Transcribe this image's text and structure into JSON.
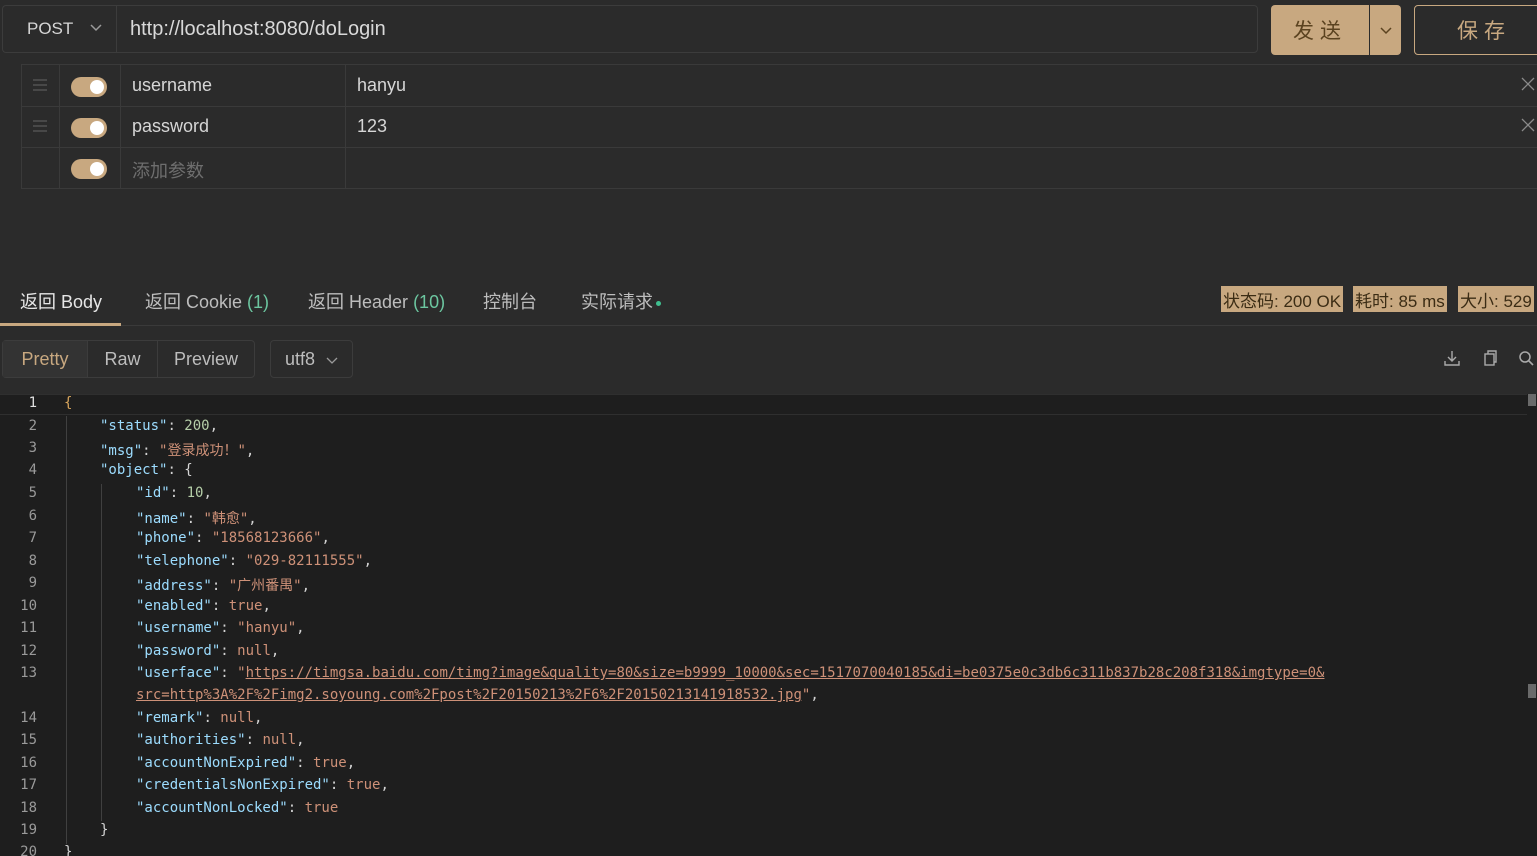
{
  "request": {
    "method": "POST",
    "url": "http://localhost:8080/doLogin",
    "send_label": "发送",
    "save_label": "保存"
  },
  "params": [
    {
      "key": "username",
      "value": "hanyu",
      "enabled": true
    },
    {
      "key": "password",
      "value": "123",
      "enabled": true
    }
  ],
  "add_param_placeholder": "添加参数",
  "response_tabs": [
    {
      "label": "返回 Body",
      "count": ""
    },
    {
      "label": "返回 Cookie",
      "count": "(1)"
    },
    {
      "label": "返回 Header",
      "count": "(10)"
    },
    {
      "label": "控制台",
      "count": ""
    },
    {
      "label": "实际请求",
      "count": ""
    }
  ],
  "status": {
    "status_code": "状态码: 200 OK",
    "time": "耗时: 85 ms",
    "size": "大小: 529"
  },
  "view_modes": [
    "Pretty",
    "Raw",
    "Preview"
  ],
  "encoding": "utf8",
  "toolbar_icons": [
    "download-icon",
    "copy-icon",
    "search-icon"
  ],
  "colors": {
    "accent": "#c8a880",
    "background": "#2b2b2b",
    "editor_background": "#1e1e1e",
    "json_key": "#9cdcfe",
    "json_string": "#ce9178",
    "json_number": "#b5cea8"
  },
  "code": {
    "line_numbers": [
      "1",
      "2",
      "3",
      "4",
      "5",
      "6",
      "7",
      "8",
      "9",
      "10",
      "11",
      "12",
      "13",
      "14",
      "15",
      "16",
      "17",
      "18",
      "19",
      "20"
    ],
    "lines": [
      {
        "p": "{",
        "t": "b"
      },
      {
        "k": "\"status\"",
        "p": ": ",
        "n": "200",
        "e": ","
      },
      {
        "k": "\"msg\"",
        "p": ": ",
        "s": "\"登录成功！\"",
        "e": ","
      },
      {
        "k": "\"object\"",
        "p": ": ",
        "b": "{"
      },
      {
        "k": "\"id\"",
        "p": ": ",
        "n": "10",
        "e": ","
      },
      {
        "k": "\"name\"",
        "p": ": ",
        "s": "\"韩愈\"",
        "e": ","
      },
      {
        "k": "\"phone\"",
        "p": ": ",
        "s": "\"18568123666\"",
        "e": ","
      },
      {
        "k": "\"telephone\"",
        "p": ": ",
        "s": "\"029-82111555\"",
        "e": ","
      },
      {
        "k": "\"address\"",
        "p": ": ",
        "s": "\"广州番禺\"",
        "e": ","
      },
      {
        "k": "\"enabled\"",
        "p": ": ",
        "s": "true",
        "e": ","
      },
      {
        "k": "\"username\"",
        "p": ": ",
        "s": "\"hanyu\"",
        "e": ","
      },
      {
        "k": "\"password\"",
        "p": ": ",
        "s": "null",
        "e": ","
      },
      {
        "k": "\"userface\"",
        "p": ": ",
        "s": "\"",
        "u": "https://timgsa.baidu.com/timg?image&quality=80&size=b9999_10000&sec=1517070040185&di=be0375e0c3db6c311b837b28c208f318&imgtype=0&"
      },
      {
        "u": "src=http%3A%2F%2Fimg2.soyoung.com%2Fpost%2F20150213%2F6%2F20150213141918532.jpg",
        "s": "\"",
        "e": ","
      },
      {
        "k": "\"remark\"",
        "p": ": ",
        "s": "null",
        "e": ","
      },
      {
        "k": "\"authorities\"",
        "p": ": ",
        "s": "null",
        "e": ","
      },
      {
        "k": "\"accountNonExpired\"",
        "p": ": ",
        "s": "true",
        "e": ","
      },
      {
        "k": "\"credentialsNonExpired\"",
        "p": ": ",
        "s": "true",
        "e": ","
      },
      {
        "k": "\"accountNonLocked\"",
        "p": ": ",
        "s": "true"
      },
      {
        "p": "}"
      },
      {
        "p": "}"
      }
    ]
  }
}
